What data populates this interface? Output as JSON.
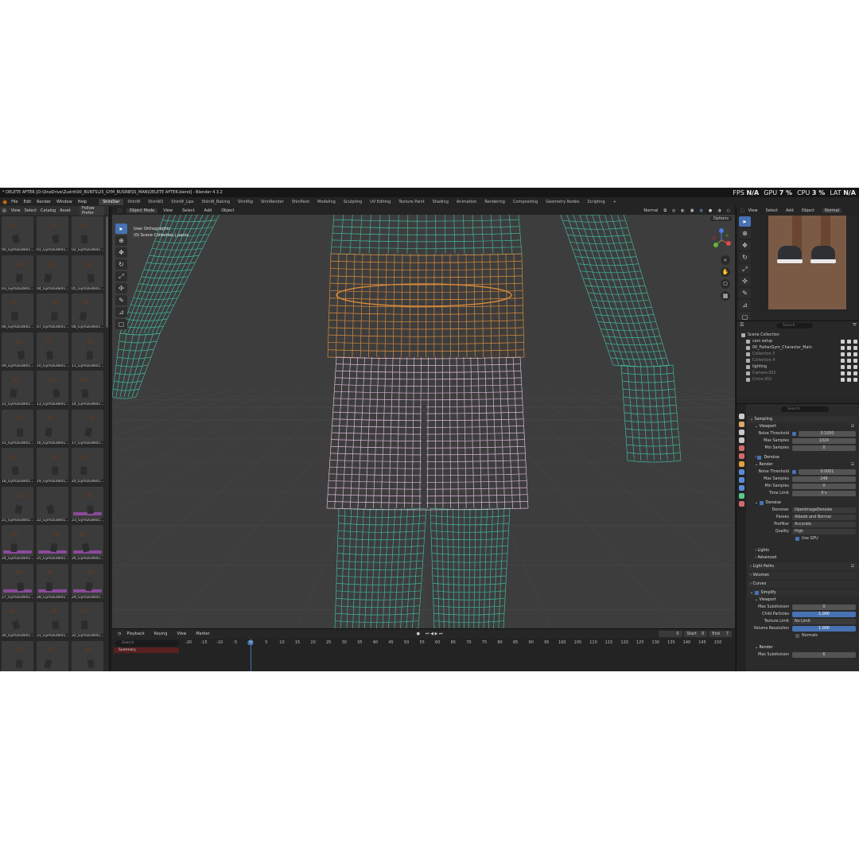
{
  "window": {
    "title": "* DELETE AFTER [D:\\OneDrive\\Zudrit\\00_BUNTS\\25_GYM_BUSINESS_MAN\\DELETE AFTER.blend] - Blender 4.3.2",
    "stats": [
      {
        "label": "FPS",
        "value": "N/A"
      },
      {
        "label": "GPU",
        "value": "7 %"
      },
      {
        "label": "CPU",
        "value": "3 %"
      },
      {
        "label": "LAT",
        "value": "N/A"
      }
    ]
  },
  "menu": [
    "File",
    "Edit",
    "Render",
    "Window",
    "Help"
  ],
  "workspaces": [
    "ShiniDar",
    "ShinW",
    "ShinW2",
    "ShinW_Lips",
    "ShinW_Baking",
    "ShinRig",
    "ShinRender",
    "ShinPack",
    "Modeling",
    "Sculpting",
    "UV Editing",
    "Texture Paint",
    "Shading",
    "Animation",
    "Rendering",
    "Compositing",
    "Geometry Nodes",
    "Scripting",
    "+"
  ],
  "active_workspace": "ShiniDar",
  "asset_browser": {
    "menu": [
      "View",
      "Select",
      "Catalog",
      "Asset"
    ],
    "filter": "Follow Prefer",
    "items": [
      {
        "label": "00_GymDude01...",
        "pink": false
      },
      {
        "label": "01_GymDude01...",
        "pink": false
      },
      {
        "label": "02_GymDude01...",
        "pink": false
      },
      {
        "label": "03_GymDude01...",
        "pink": false
      },
      {
        "label": "04_GymDude01...",
        "pink": false
      },
      {
        "label": "05_GymDude01...",
        "pink": false
      },
      {
        "label": "06_GymDude01...",
        "pink": false
      },
      {
        "label": "07_GymDude01...",
        "pink": false
      },
      {
        "label": "08_GymDude01...",
        "pink": false
      },
      {
        "label": "09_GymDude01...",
        "pink": false
      },
      {
        "label": "10_GymDude01...",
        "pink": false
      },
      {
        "label": "11_GymDude01...",
        "pink": false
      },
      {
        "label": "12_GymDude01...",
        "pink": false
      },
      {
        "label": "13_GymDude01...",
        "pink": false
      },
      {
        "label": "14_GymDude01...",
        "pink": false
      },
      {
        "label": "15_GymDude01...",
        "pink": false
      },
      {
        "label": "16_GymDude01...",
        "pink": false
      },
      {
        "label": "17_GymDude01...",
        "pink": false
      },
      {
        "label": "18_GymDude01...",
        "pink": false
      },
      {
        "label": "19_GymDude01...",
        "pink": false
      },
      {
        "label": "20_GymDude01...",
        "pink": false
      },
      {
        "label": "21_GymDude01...",
        "pink": false
      },
      {
        "label": "22_GymDude01...",
        "pink": false
      },
      {
        "label": "23_GymDude01...",
        "pink": true
      },
      {
        "label": "24_GymDude01...",
        "pink": true
      },
      {
        "label": "25_GymDude01...",
        "pink": true
      },
      {
        "label": "26_GymDude01...",
        "pink": true
      },
      {
        "label": "27_GymDude01...",
        "pink": true
      },
      {
        "label": "28_GymDude01...",
        "pink": true
      },
      {
        "label": "29_GymDude01...",
        "pink": true
      },
      {
        "label": "30_GymDude01...",
        "pink": false
      },
      {
        "label": "31_GymDude01...",
        "pink": false
      },
      {
        "label": "32_GymDude01...",
        "pink": false
      },
      {
        "label": "",
        "pink": false
      },
      {
        "label": "",
        "pink": false
      },
      {
        "label": "",
        "pink": false
      }
    ]
  },
  "viewport": {
    "mode": "Object Mode",
    "menu": [
      "View",
      "Select",
      "Add",
      "Object"
    ],
    "orientation": "Normal",
    "options": "Options",
    "info_line1": "User Orthographic",
    "info_line2": "(0) Scene Collection | pants",
    "wire_colors": {
      "body": "#3fb59a",
      "shirt": "#d98a3a",
      "pants": "#d8b9d6",
      "bg": "#3d3d3d"
    }
  },
  "timeline": {
    "menu": [
      "Playback",
      "Keying",
      "View",
      "Marker"
    ],
    "search_placeholder": "Search",
    "summary": "Summary",
    "ticks": [
      "-20",
      "-15",
      "-10",
      "-5",
      "0",
      "5",
      "10",
      "15",
      "20",
      "25",
      "30",
      "35",
      "40",
      "45",
      "50",
      "55",
      "60",
      "65",
      "70",
      "75",
      "80",
      "85",
      "90",
      "95",
      "100",
      "105",
      "110",
      "115",
      "120",
      "125",
      "130",
      "135",
      "140",
      "145",
      "150"
    ],
    "current_frame": "0",
    "start_label": "Start",
    "start": "0",
    "end_label": "End",
    "end": "7"
  },
  "right_panel": {
    "menu": [
      "View",
      "Select",
      "Add",
      "Object"
    ],
    "orientation": "Normal",
    "outliner": {
      "search_placeholder": "Search",
      "rows": [
        {
          "label": "Scene Collection",
          "dim": false
        },
        {
          "label": "cam setup",
          "dim": false
        },
        {
          "label": "00_FatherGym_Character_Main",
          "dim": false
        },
        {
          "label": "Collection 3",
          "dim": true
        },
        {
          "label": "Collection 4",
          "dim": true
        },
        {
          "label": "lighting",
          "dim": false
        },
        {
          "label": "Camera.002",
          "dim": true
        },
        {
          "label": "Circle.002",
          "dim": true
        }
      ]
    },
    "properties": {
      "search_placeholder": "Search",
      "sampling": "Sampling",
      "viewport": "Viewport",
      "noise_threshold_label": "Noise Threshold",
      "vp_noise_threshold": "0.1000",
      "max_samples_label": "Max Samples",
      "vp_max_samples": "1024",
      "min_samples_label": "Min Samples",
      "vp_min_samples": "0",
      "denoise": "Denoise",
      "render": "Render",
      "r_noise_threshold": "0.0001",
      "r_max_samples": "248",
      "r_min_samples": "0",
      "time_limit_label": "Time Limit",
      "time_limit": "0 s",
      "denoiser_label": "Denoiser",
      "denoiser": "OpenImageDenoise",
      "passes_label": "Passes",
      "passes": "Albedo and Normal",
      "prefilter_label": "Prefilter",
      "prefilter": "Accurate",
      "quality_label": "Quality",
      "quality": "High",
      "use_gpu": "Use GPU",
      "lights": "Lights",
      "advanced": "Advanced",
      "light_paths": "Light Paths",
      "volumes": "Volumes",
      "curves": "Curves",
      "simplify": "Simplify",
      "s_viewport": "Viewport",
      "max_subdivision_label": "Max Subdivision",
      "s_max_subdivision": "0",
      "child_particles_label": "Child Particles",
      "child_particles": "1.000",
      "texture_limit_label": "Texture Limit",
      "texture_limit": "No Limit",
      "volume_resolution_label": "Volume Resolution",
      "volume_resolution": "1.000",
      "normals": "Normals",
      "s_render": "Render",
      "r_max_subdivision": "6"
    }
  }
}
